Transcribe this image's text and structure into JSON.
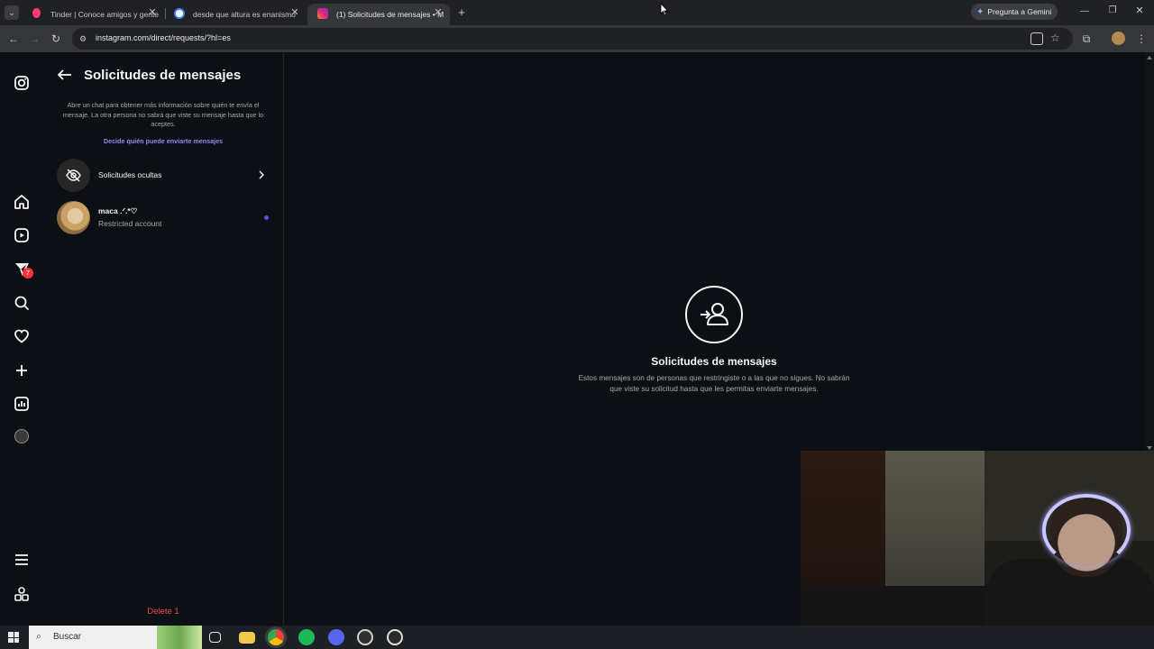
{
  "browser": {
    "tabs": [
      {
        "title": "Tinder | Conoce amigos y gente",
        "favicon_color": "#fe3c72"
      },
      {
        "title": "desde que altura es enanismo",
        "favicon_color": "#4285f4"
      },
      {
        "title": "(1) Solicitudes de mensajes • M",
        "favicon_color": "#e1306c"
      }
    ],
    "new_tab_symbol": "+",
    "url": "instagram.com/direct/requests/?hl=es",
    "gemini_label": "Pregunta a Gemini"
  },
  "instagram": {
    "rail_icons": [
      "instagram-logo",
      "home",
      "reels",
      "messages",
      "search",
      "notifications",
      "create",
      "dashboard",
      "profile",
      "menu",
      "more"
    ],
    "messages_badge": "7",
    "panel": {
      "title": "Solicitudes de mensajes",
      "description": "Abre un chat para obtener más información sobre quién te envía el mensaje. La otra persona no sabrá que viste su mensaje hasta que lo aceptes.",
      "decide_link": "Decide quién puede enviarte mensajes",
      "hidden_requests_label": "Solicitudes ocultas",
      "request": {
        "name": "maca .ᐟ.*♡",
        "status": "Restricted account"
      },
      "delete_label": "Delete 1"
    },
    "main": {
      "title": "Solicitudes de mensajes",
      "body": "Estos mensajes son de personas que restringiste o a las que no sigues. No sabrán que viste su solicitud hasta que les permitas enviarte mensajes."
    },
    "accent_color": "#0095f6",
    "link_color": "#8a8cf5",
    "danger_color": "#ed4956",
    "unread_dot_color": "#5851db"
  },
  "taskbar": {
    "search_placeholder": "Buscar"
  }
}
